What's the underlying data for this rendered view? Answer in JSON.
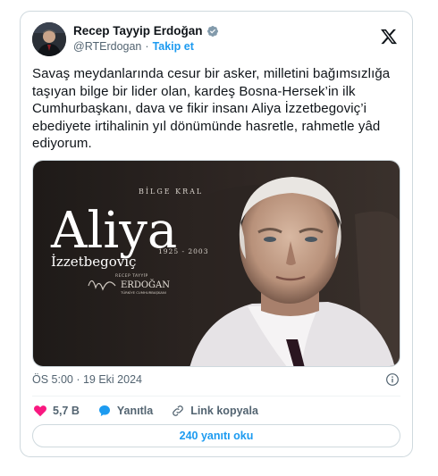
{
  "tweet": {
    "author_name": "Recep Tayyip Erdoğan",
    "handle": "@RTErdogan",
    "separator": "·",
    "follow_label": "Takip et",
    "text": "Savaş meydanlarında cesur bir asker,  milletini bağımsızlığa taşıyan bilge bir lider olan, kardeş Bosna-Hersek’in ilk Cumhurbaşkanı, dava ve fikir insanı Aliya İzzetbegoviç’i ebediyete irtihalinin yıl dönümünde hasretle, rahmetle yâd ediyorum.",
    "timestamp": "ÖS 5:00 · 19 Eki 2024",
    "likes": "5,7 B",
    "reply_label": "Yanıtla",
    "copy_link_label": "Link kopyala",
    "read_replies_label": "240 yanıtı oku"
  },
  "media": {
    "small_caps": "BİLGE KRAL",
    "big_name": "Aliya",
    "surname": "İzzetbegoviç",
    "years": "1925 - 2003",
    "signature_top": "RECEP TAYYİP",
    "signature_name": "ERDOĞAN",
    "signature_sub": "TÜRKİYE CUMHURBAŞKANI"
  },
  "colors": {
    "accent": "#1d9bf0",
    "like": "#f91880",
    "text": "#0f1419",
    "muted": "#536471",
    "border": "#cfd9de"
  },
  "icons": [
    "verified-badge-icon",
    "x-logo-icon",
    "info-icon",
    "heart-icon",
    "reply-bubble-icon",
    "link-icon"
  ]
}
